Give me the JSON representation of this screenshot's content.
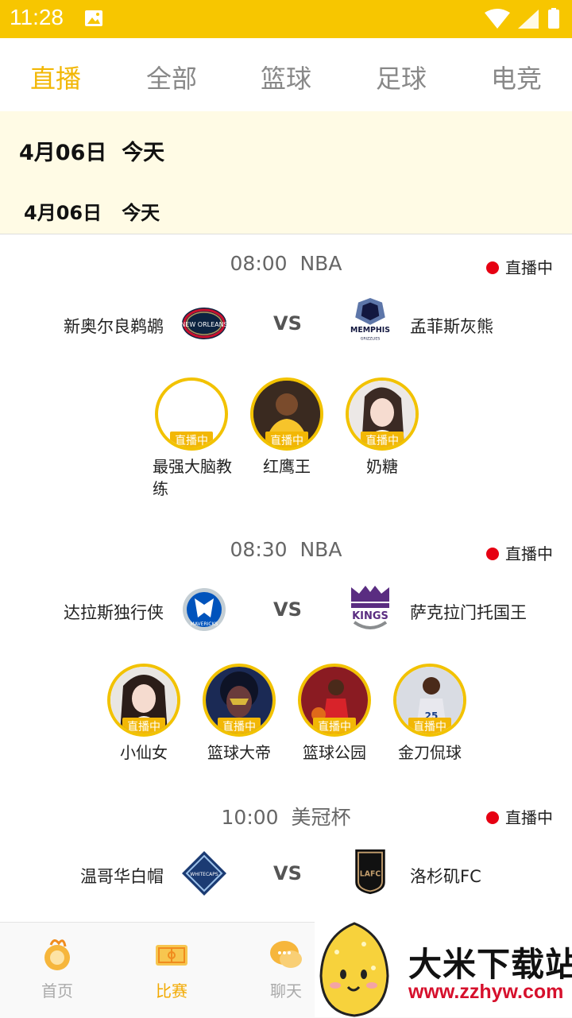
{
  "status_bar": {
    "time": "11:28"
  },
  "tabs": [
    {
      "label": "直播",
      "active": true
    },
    {
      "label": "全部",
      "active": false
    },
    {
      "label": "篮球",
      "active": false
    },
    {
      "label": "足球",
      "active": false
    },
    {
      "label": "电竞",
      "active": false
    }
  ],
  "date_header": {
    "date": "4月06日",
    "day": "今天"
  },
  "date_subheader": {
    "date": "4月06日",
    "day": "今天"
  },
  "matches": [
    {
      "time": "08:00",
      "league": "NBA",
      "status": "直播中",
      "home": "新奥尔良鹈鹕",
      "vs": "VS",
      "away": "孟菲斯灰熊",
      "home_logo_text": "NEW ORLEANS",
      "away_logo_text": "MEMPHIS",
      "streamers": [
        {
          "name": "最强大脑教练",
          "badge": "直播中"
        },
        {
          "name": "红鹰王",
          "badge": "直播中"
        },
        {
          "name": "奶糖",
          "badge": "直播中"
        }
      ]
    },
    {
      "time": "08:30",
      "league": "NBA",
      "status": "直播中",
      "home": "达拉斯独行侠",
      "vs": "VS",
      "away": "萨克拉门托国王",
      "home_logo_text": "MAVERICKS",
      "away_logo_text": "KINGS",
      "streamers": [
        {
          "name": "小仙女",
          "badge": "直播中"
        },
        {
          "name": "篮球大帝",
          "badge": "直播中"
        },
        {
          "name": "篮球公园",
          "badge": "直播中"
        },
        {
          "name": "金刀侃球",
          "badge": "直播中"
        }
      ]
    },
    {
      "time": "10:00",
      "league": "美冠杯",
      "status": "直播中",
      "home": "温哥华白帽",
      "vs": "VS",
      "away": "洛杉矶FC",
      "home_logo_text": "WHITECAPS",
      "away_logo_text": "LAFC"
    }
  ],
  "bottom_nav": [
    {
      "label": "首页",
      "icon": "home-icon",
      "active": false
    },
    {
      "label": "比赛",
      "icon": "match-icon",
      "active": true
    },
    {
      "label": "聊天",
      "icon": "chat-icon",
      "active": false
    }
  ],
  "watermark": {
    "title": "大米下载站",
    "url": "www.zzhyw.com"
  },
  "colors": {
    "accent": "#f2b705",
    "status_bar": "#f7c600",
    "live_dot": "#e60012"
  }
}
